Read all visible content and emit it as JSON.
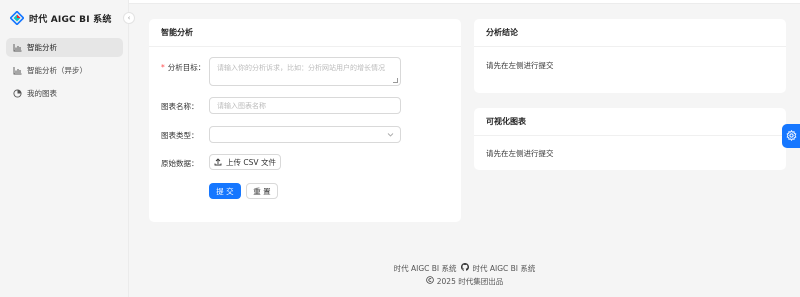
{
  "brand": {
    "title": "时代 AIGC BI 系统",
    "accent": "#1677ff"
  },
  "sidebar": {
    "items": [
      {
        "label": "智能分析",
        "icon": "bar-chart-icon",
        "active": true
      },
      {
        "label": "智能分析（异步）",
        "icon": "bar-chart-icon",
        "active": false
      },
      {
        "label": "我的图表",
        "icon": "pie-chart-icon",
        "active": false
      }
    ]
  },
  "form": {
    "title": "智能分析",
    "goal_label": "分析目标：",
    "goal_placeholder": "请输入你的分析诉求，比如：分析网站用户的增长情况",
    "name_label": "图表名称：",
    "name_placeholder": "请输入图表名称",
    "type_label": "图表类型：",
    "type_value": "",
    "file_label": "原始数据：",
    "upload_label": "上传 CSV 文件",
    "submit_label": "提 交",
    "reset_label": "重 置"
  },
  "result": {
    "title": "分析结论",
    "text": "请先在左侧进行提交"
  },
  "chart": {
    "title": "可视化图表",
    "text": "请先在左侧进行提交"
  },
  "footer": {
    "left": "时代 AIGC BI 系统",
    "right": "时代 AIGC BI 系统",
    "copyright": "2025 时代集团出品"
  }
}
